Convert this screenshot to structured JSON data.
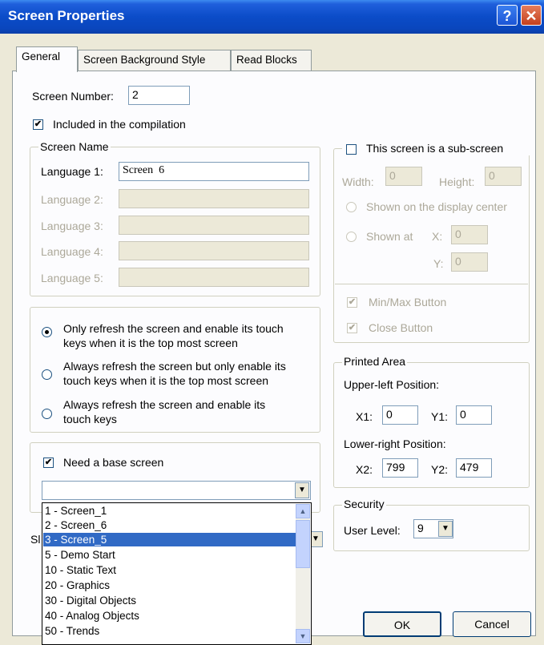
{
  "window": {
    "title": "Screen Properties",
    "help_glyph": "?",
    "close_glyph": "✕"
  },
  "tabs": [
    "General",
    "Screen Background Style",
    "Read Blocks"
  ],
  "screen_number": {
    "label": "Screen Number:",
    "value": "2"
  },
  "compilation": {
    "label": "Included in the compilation",
    "checked": true
  },
  "screen_name": {
    "title": "Screen Name",
    "languages": [
      {
        "label": "Language 1:",
        "value": "Screen  6"
      },
      {
        "label": "Language 2:",
        "value": ""
      },
      {
        "label": "Language 3:",
        "value": ""
      },
      {
        "label": "Language 4:",
        "value": ""
      },
      {
        "label": "Language 5:",
        "value": ""
      }
    ]
  },
  "refresh": {
    "options": [
      {
        "line1": "Only refresh the screen and enable its touch",
        "line2": "keys when it is the top most screen"
      },
      {
        "line1": "Always refresh the screen but only enable its",
        "line2": "touch keys when it is the top most screen"
      },
      {
        "line1": "Always refresh the screen and enable its",
        "line2": "touch keys"
      }
    ],
    "selected_index": 0
  },
  "base_screen": {
    "label": "Need a base screen",
    "checked": true,
    "value": ""
  },
  "dropdown_list": {
    "items": [
      "1 - Screen_1",
      "2 - Screen_6",
      "3 - Screen_5",
      "5 - Demo Start",
      "10 - Static Text",
      "20 - Graphics",
      "30 - Digital Objects",
      "40 - Analog Objects",
      "50 - Trends"
    ],
    "selected_index": 2
  },
  "hidden_label": "Sl",
  "subscreen": {
    "label": "This screen is a sub-screen",
    "checked": false,
    "width_label": "Width:",
    "width_value": "0",
    "height_label": "Height:",
    "height_value": "0",
    "center_label": "Shown on the display center",
    "shown_at_label": "Shown at",
    "x_label": "X:",
    "x_value": "0",
    "y_label": "Y:",
    "y_value": "0",
    "minmax_label": "Min/Max Button",
    "close_label": "Close Button"
  },
  "printed_area": {
    "title": "Printed Area",
    "upper_left": "Upper-left Position:",
    "x1_label": "X1:",
    "x1": "0",
    "y1_label": "Y1:",
    "y1": "0",
    "lower_right": "Lower-right Position:",
    "x2_label": "X2:",
    "x2": "799",
    "y2_label": "Y2:",
    "y2": "479"
  },
  "security": {
    "title": "Security",
    "user_level_label": "User Level:",
    "user_level": "9"
  },
  "buttons": {
    "ok": "OK",
    "cancel": "Cancel"
  }
}
